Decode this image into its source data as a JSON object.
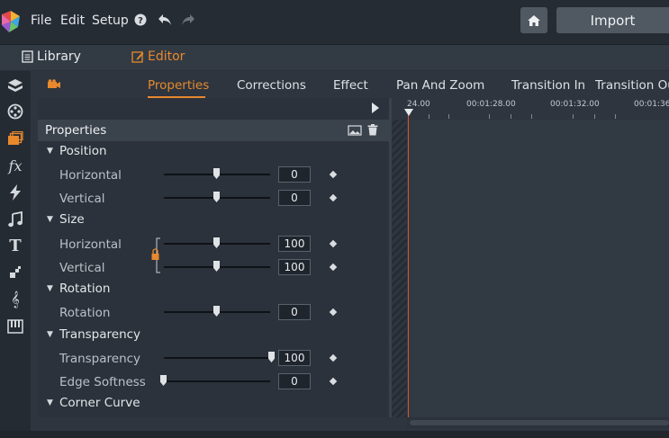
{
  "menu": {
    "file": "File",
    "edit": "Edit",
    "setup": "Setup"
  },
  "header": {
    "import_label": "Import"
  },
  "modes": {
    "library": "Library",
    "editor": "Editor"
  },
  "tabs": [
    "Properties",
    "Corrections",
    "Effect",
    "Pan And Zoom",
    "Transition In",
    "Transition Ou"
  ],
  "panel": {
    "title": "Properties"
  },
  "sections": {
    "position": "Position",
    "size": "Size",
    "rotation": "Rotation",
    "transparency": "Transparency",
    "corner_curve": "Corner Curve"
  },
  "params": {
    "pos_h": {
      "label": "Horizontal",
      "value": "0"
    },
    "pos_v": {
      "label": "Vertical",
      "value": "0"
    },
    "size_h": {
      "label": "Horizontal",
      "value": "100"
    },
    "size_v": {
      "label": "Vertical",
      "value": "100"
    },
    "rotation": {
      "label": "Rotation",
      "value": "0"
    },
    "transparency": {
      "label": "Transparency",
      "value": "100"
    },
    "edge_softness": {
      "label": "Edge Softness",
      "value": "0"
    }
  },
  "timeline": {
    "ticks": [
      "24.00",
      "00:01:28.00",
      "00:01:32.00",
      "00:01:36."
    ]
  },
  "colors": {
    "accent": "#e8892d",
    "playhead": "#d2552c"
  }
}
